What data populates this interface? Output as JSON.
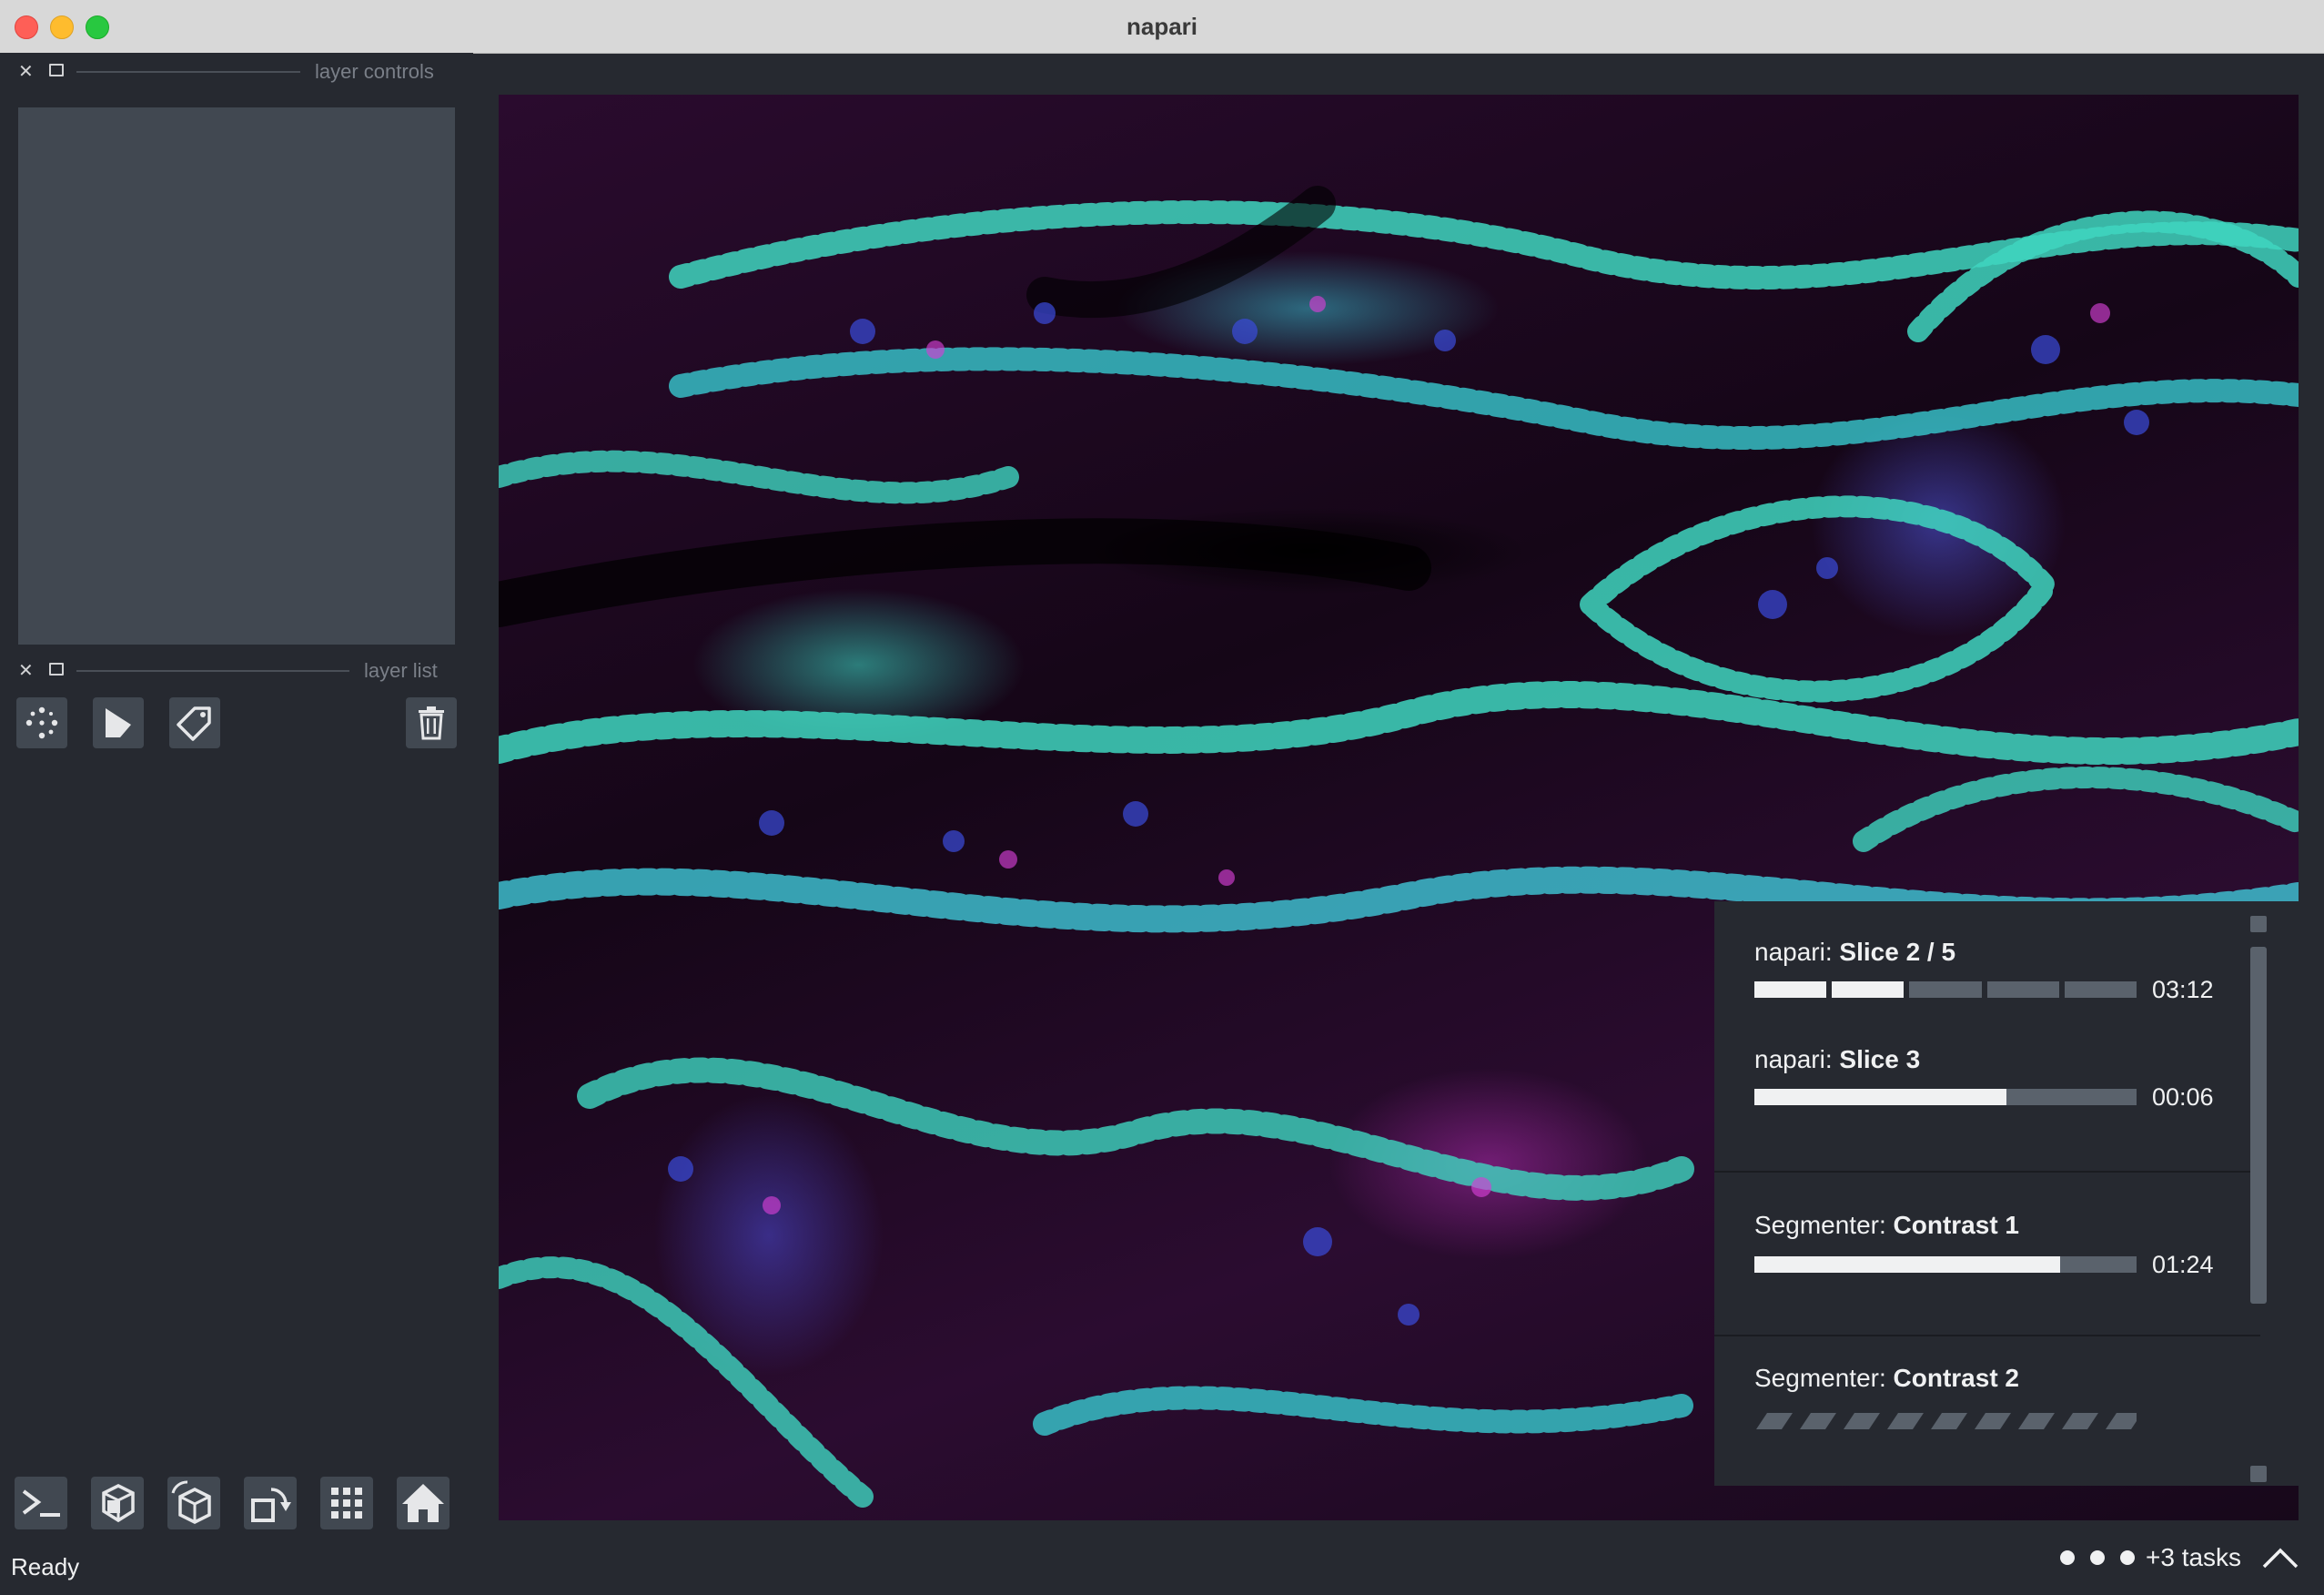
{
  "window": {
    "title": "napari"
  },
  "docks": {
    "layer_controls": {
      "title": "layer controls"
    },
    "layer_list": {
      "title": "layer list"
    }
  },
  "layer_buttons": [
    {
      "name": "new-points-layer-button",
      "icon": "points-icon"
    },
    {
      "name": "new-shapes-layer-button",
      "icon": "shapes-icon"
    },
    {
      "name": "new-labels-layer-button",
      "icon": "labels-tag-icon"
    },
    {
      "name": "delete-layer-button",
      "icon": "trash-icon"
    }
  ],
  "viewer_buttons": [
    {
      "name": "console-button",
      "icon": "console-icon"
    },
    {
      "name": "ndisplay-button",
      "icon": "2d-3d-icon"
    },
    {
      "name": "roll-dims-button",
      "icon": "cube-icon"
    },
    {
      "name": "transpose-button",
      "icon": "transpose-icon"
    },
    {
      "name": "grid-view-button",
      "icon": "grid-icon"
    },
    {
      "name": "reset-view-button",
      "icon": "home-icon"
    }
  ],
  "activity": {
    "tasks": [
      {
        "source": "napari: ",
        "name": "Slice 2 / 5",
        "time": "03:12",
        "mode": "steps",
        "steps_total": 5,
        "steps_done": 2
      },
      {
        "source": "napari: ",
        "name": "Slice 3",
        "time": "00:06",
        "mode": "bar",
        "progress": 0.66
      },
      {
        "source": "Segmenter: ",
        "name": "Contrast 1",
        "time": "01:24",
        "mode": "bar",
        "progress": 0.8
      },
      {
        "source": "Segmenter: ",
        "name": "Contrast 2",
        "time": "",
        "mode": "indeterminate"
      }
    ]
  },
  "status": {
    "text": "Ready",
    "tasks_label": "+3 tasks"
  },
  "colors": {
    "bg": "#262930",
    "panel": "#414851",
    "text": "#f0f1f2",
    "bar_fill": "#f0f1f2",
    "bar_track": "#5a626c"
  }
}
